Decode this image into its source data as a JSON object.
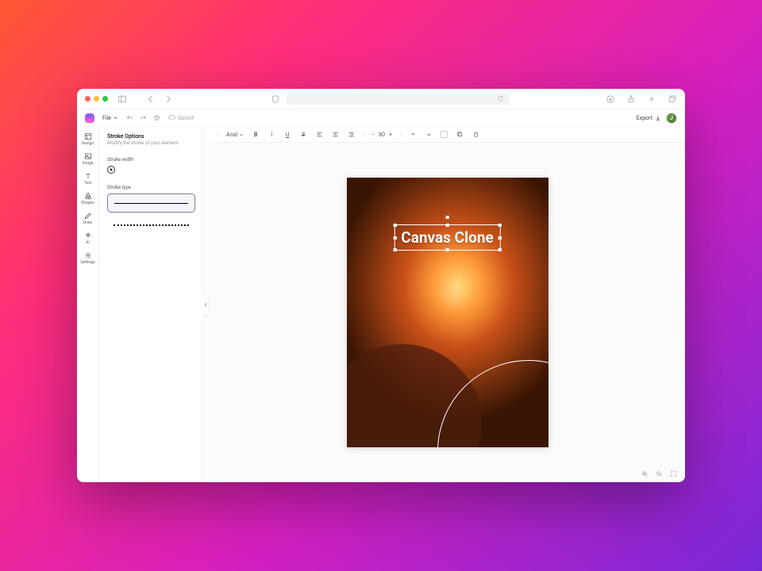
{
  "appbar": {
    "file_label": "File",
    "cloud_label": "Saved!",
    "export_label": "Export",
    "avatar_initial": "J"
  },
  "rail": {
    "items": [
      {
        "label": "Design",
        "icon": "layout"
      },
      {
        "label": "Image",
        "icon": "image"
      },
      {
        "label": "Text",
        "icon": "text"
      },
      {
        "label": "Shapes",
        "icon": "shapes"
      },
      {
        "label": "Draw",
        "icon": "pencil"
      },
      {
        "label": "AI",
        "icon": "sparkle"
      },
      {
        "label": "Settings",
        "icon": "gear"
      }
    ]
  },
  "panel": {
    "title": "Stroke Options",
    "subtitle": "Modify the stroke of your element",
    "width_label": "Stroke width",
    "type_label": "Stroke type",
    "options": [
      {
        "name": "solid",
        "selected": true
      },
      {
        "name": "dotted",
        "selected": false
      }
    ]
  },
  "format_bar": {
    "font": "Arial",
    "size": "80"
  },
  "canvas": {
    "text_value": "Canvas Clone"
  }
}
